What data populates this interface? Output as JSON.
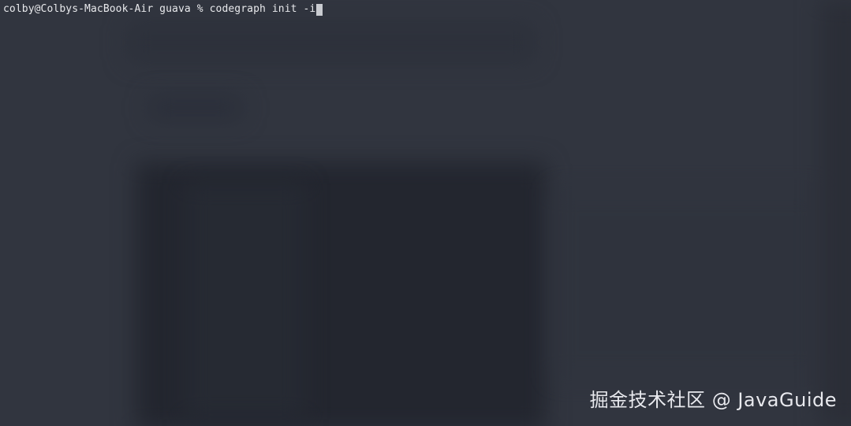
{
  "terminal": {
    "prompt": "colby@Colbys-MacBook-Air guava % ",
    "command": "codegraph init -i"
  },
  "watermark": {
    "text": "掘金技术社区 @ JavaGuide"
  },
  "colors": {
    "background": "#31353f",
    "text": "#e8e9ec",
    "cursor": "#c9cbd0"
  }
}
